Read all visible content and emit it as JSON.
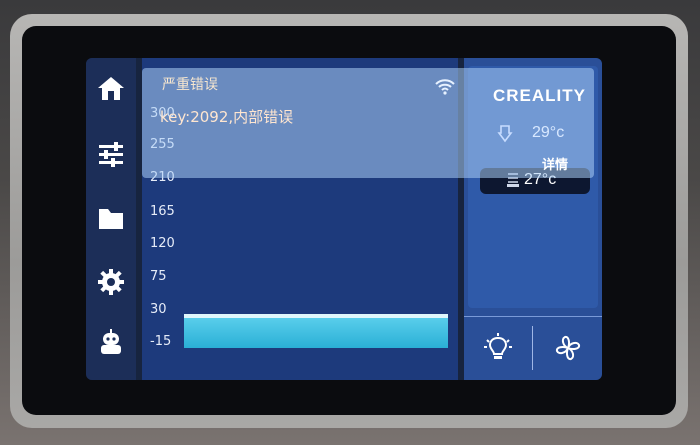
{
  "error_dialog": {
    "title": "严重错误",
    "message": "key:2092,内部错误",
    "brand": "CREALITY",
    "nozzle_temp": "29°c",
    "details_label": "详情"
  },
  "status": {
    "bed_temp": "27°c"
  },
  "chart": {
    "y_labels": [
      "300",
      "255",
      "210",
      "165",
      "120",
      "75",
      "30",
      "-15"
    ]
  },
  "sidebar": {
    "items": [
      {
        "icon": "home-icon"
      },
      {
        "icon": "sliders-icon"
      },
      {
        "icon": "folder-icon"
      },
      {
        "icon": "gear-icon"
      },
      {
        "icon": "robot-icon"
      }
    ]
  },
  "controls": {
    "light_icon": "lightbulb-icon",
    "fan_icon": "fan-icon"
  },
  "colors": {
    "error_text": "#ffe6d0",
    "temp_bar": "#2ab0d6",
    "panel_blue": "#1d3a7c"
  },
  "chart_data": {
    "type": "bar",
    "categories": [
      ""
    ],
    "values": [
      30
    ],
    "title": "",
    "xlabel": "",
    "ylabel": "",
    "ylim": [
      -15,
      300
    ],
    "yticks": [
      300,
      255,
      210,
      165,
      120,
      75,
      30,
      -15
    ],
    "grid": false
  }
}
